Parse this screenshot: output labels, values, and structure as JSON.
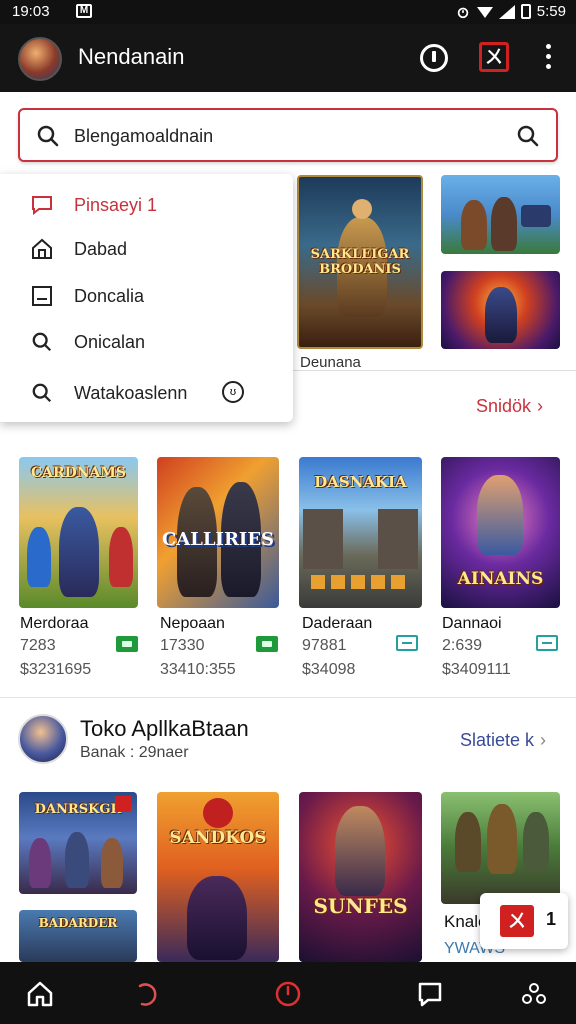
{
  "status_bar": {
    "time": "19:03",
    "mail_icon": "M",
    "clock_right": "5:59"
  },
  "app_bar": {
    "title": "Nendanain",
    "store_icon_glyph": "ㄨ"
  },
  "search": {
    "value": "Blengamoaldnain"
  },
  "dropdown": {
    "items": [
      {
        "icon": "message-icon",
        "label": "Pinsaeyi 1",
        "active": true
      },
      {
        "icon": "home-icon",
        "label": "Dabad",
        "active": false
      },
      {
        "icon": "window-icon",
        "label": "Doncalia",
        "active": false
      },
      {
        "icon": "search-icon",
        "label": "Onicalan",
        "active": false
      },
      {
        "icon": "search-icon",
        "label": "Watakoaslenn",
        "active": false
      }
    ],
    "extra_icon": "ʊ"
  },
  "featured": {
    "art_titles": [
      "SARKLEIGAR BRODANIS",
      "",
      ""
    ],
    "caption": "Deunana"
  },
  "section1": {
    "see_all": "Snidök",
    "cards": [
      {
        "art": "CARDNAMS",
        "name": "Merdoraa",
        "num": "7283",
        "price": "$3231695",
        "badge": "green"
      },
      {
        "art": "CALLIRIES",
        "name": "Nepoaan",
        "num": "17330",
        "price": "33410:355",
        "badge": "green"
      },
      {
        "art": "DASNAKIA",
        "name": "Daderaan",
        "num": "97881",
        "price": "$34098",
        "badge": "teal"
      },
      {
        "art": "AINAINS",
        "name": "Dannaoi",
        "num": "2:639",
        "price": "$3409111",
        "badge": "teal"
      }
    ]
  },
  "section2": {
    "title": "Toko ApllkaBtaan",
    "subtitle": "Banak : 29naer",
    "see_all": "Slatiete k",
    "arts": [
      "DANRSKGR",
      "SANDKOS",
      "SUNFES",
      "",
      "BADARDER"
    ],
    "partial_name": "Knalo",
    "partial_sub": "YWAWS",
    "floating_glyph": "ㄨ",
    "floating_count": "1"
  },
  "colors": {
    "accent": "#c8323c",
    "bar": "#151515",
    "link_blue": "#3a4a9a"
  }
}
